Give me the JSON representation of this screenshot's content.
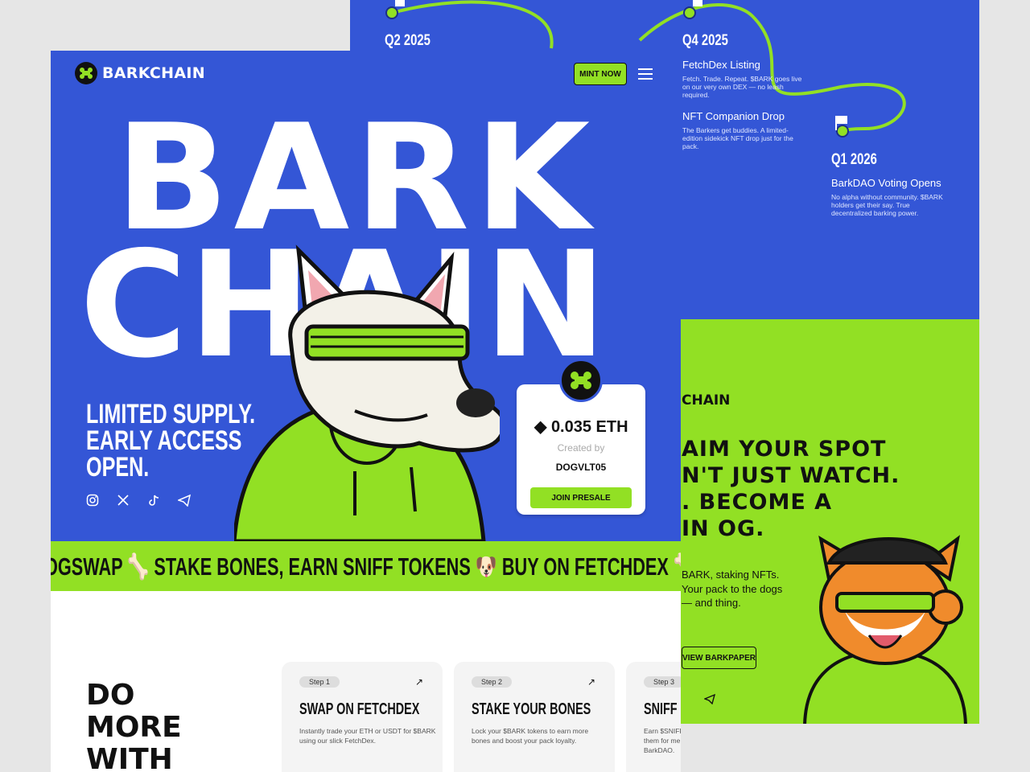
{
  "roadmap": {
    "q2": "Q2 2025",
    "q4": "Q4 2025",
    "q1": "Q1 2026",
    "items": [
      {
        "title": "FetchDex Listing",
        "desc": "Fetch. Trade. Repeat. $BARK goes live on our very own DEX — no leash required."
      },
      {
        "title": "NFT Companion Drop",
        "desc": "The Barkers get buddies. A limited-edition sidekick NFT drop just for the pack."
      },
      {
        "title": "BarkDAO Voting Opens",
        "desc": "No alpha without community. $BARK holders get their say. True decentralized barking power."
      }
    ]
  },
  "og": {
    "brand": "CHAIN",
    "headline_1": "AIM YOUR SPOT",
    "headline_2": "N'T JUST WATCH.",
    "headline_3": ". BECOME A",
    "headline_4": "IN OG.",
    "desc": "BARK, staking NFTs. Your pack to the dogs — and thing.",
    "button": "VIEW BARKPAPER"
  },
  "header": {
    "logo": "BARKCHAIN",
    "mint": "MINT NOW"
  },
  "hero": {
    "line1": "BARK",
    "line2": "CHAIN",
    "tagline": "LIMITED SUPPLY. EARLY ACCESS OPEN."
  },
  "price_card": {
    "price": "0.035 ETH",
    "created_by": "Created by",
    "creator": "DOGVLT05",
    "button": "JOIN PRESALE"
  },
  "ticker": "OGSWAP 🦴 STAKE BONES, EARN SNIFF TOKENS 🐶 BUY ON FETCHDEX 🦴 DOG PAPER",
  "do_more": [
    "DO",
    "MORE",
    "WITH"
  ],
  "steps": [
    {
      "step": "Step 1",
      "title": "SWAP ON FETCHDEX",
      "desc": "Instantly trade your ETH or USDT for $BARK using our slick FetchDex."
    },
    {
      "step": "Step 2",
      "title": "STAKE YOUR BONES",
      "desc": "Lock your $BARK tokens to earn more bones and boost your pack loyalty."
    },
    {
      "step": "Step 3",
      "title": "SNIFF O",
      "desc": "Earn $SNIFF them for me BarkDAO."
    }
  ],
  "colors": {
    "blue": "#3456d6",
    "lime": "#92e024",
    "ink": "#111111"
  }
}
